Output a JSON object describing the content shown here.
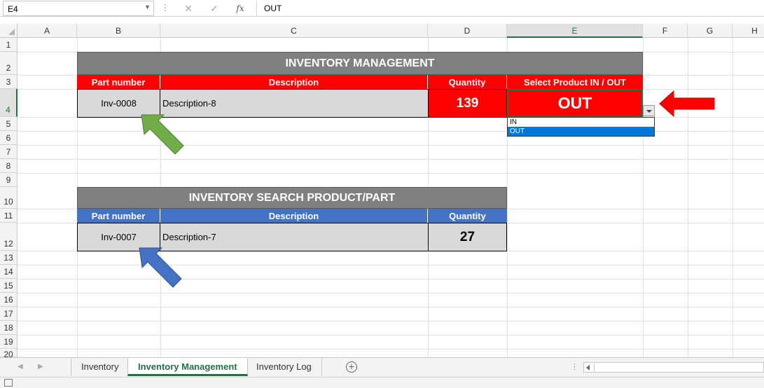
{
  "formula_bar": {
    "name_box": "E4",
    "fx_label": "fx",
    "formula_value": "OUT"
  },
  "columns": [
    "A",
    "B",
    "C",
    "D",
    "E",
    "F",
    "G",
    "H"
  ],
  "rows": [
    "1",
    "2",
    "3",
    "4",
    "5",
    "6",
    "7",
    "8",
    "9",
    "10",
    "11",
    "12",
    "13",
    "14",
    "15",
    "16",
    "17",
    "18",
    "19",
    "20"
  ],
  "active_cell": "E4",
  "management": {
    "title": "INVENTORY MANAGEMENT",
    "headers": {
      "part_number": "Part number",
      "description": "Description",
      "quantity": "Quantity",
      "select": "Select Product IN / OUT"
    },
    "row": {
      "part_number": "Inv-0008",
      "description": "Description-8",
      "quantity": "139",
      "direction": "OUT"
    },
    "dropdown_options": [
      "IN",
      "OUT"
    ],
    "dropdown_selected": "OUT"
  },
  "search": {
    "title": "INVENTORY SEARCH PRODUCT/PART",
    "headers": {
      "part_number": "Part number",
      "description": "Description",
      "quantity": "Quantity"
    },
    "row": {
      "part_number": "Inv-0007",
      "description": "Description-7",
      "quantity": "27"
    }
  },
  "sheet_tabs": {
    "tabs": [
      "Inventory",
      "Inventory Management",
      "Inventory Log"
    ],
    "active": "Inventory Management"
  },
  "colors": {
    "banner": "#808080",
    "header_red": "#ff0000",
    "header_blue": "#4472c4",
    "cell_gray": "#d9d9d9",
    "excel_green": "#217346",
    "arrow_green": "#70ad47",
    "arrow_blue": "#4472c4",
    "arrow_red": "#ff0000"
  }
}
